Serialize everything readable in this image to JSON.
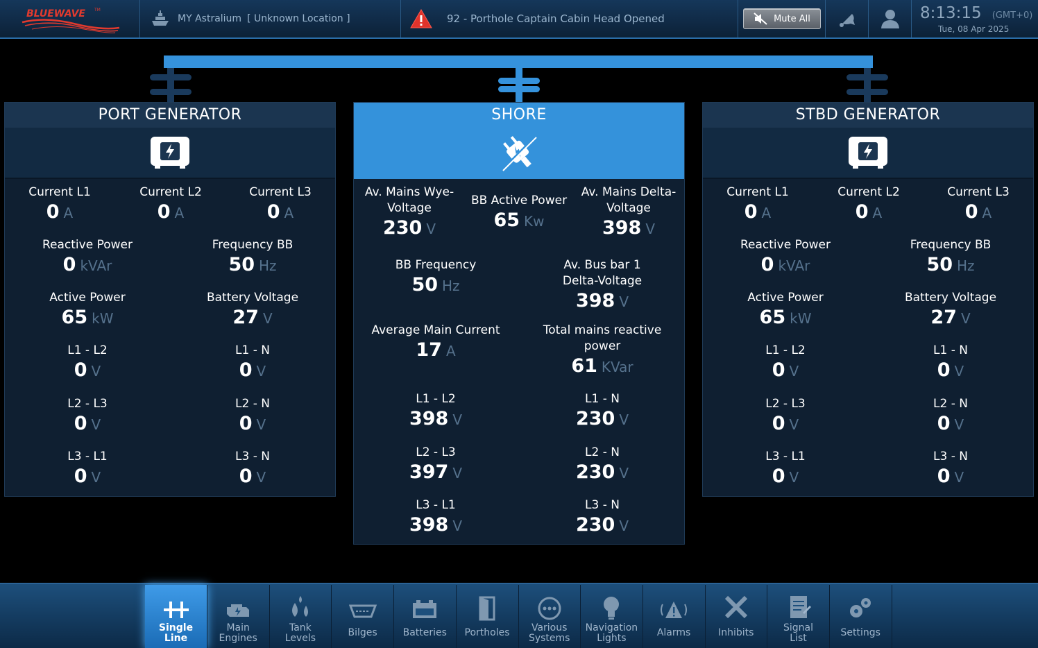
{
  "header": {
    "vessel_name": "MY Astralium",
    "location": "[ Unknown Location ]",
    "alarm_text": "92 - Porthole Captain Cabin Head Opened",
    "mute_label": "Mute All",
    "time": "8:13:15",
    "timezone": "(GMT+0)",
    "date": "Tue, 08 Apr 2025"
  },
  "port": {
    "title": "PORT GENERATOR",
    "fields": [
      {
        "label": "Current L1",
        "value": "0",
        "unit": "A"
      },
      {
        "label": "Current L2",
        "value": "0",
        "unit": "A"
      },
      {
        "label": "Current L3",
        "value": "0",
        "unit": "A"
      },
      {
        "label": "Reactive Power",
        "value": "0",
        "unit": "kVAr"
      },
      {
        "label": "Frequency BB",
        "value": "50",
        "unit": "Hz"
      },
      {
        "label": "Active Power",
        "value": "65",
        "unit": "kW"
      },
      {
        "label": "Battery Voltage",
        "value": "27",
        "unit": "V"
      },
      {
        "label": "L1 - L2",
        "value": "0",
        "unit": "V"
      },
      {
        "label": "L1 - N",
        "value": "0",
        "unit": "V"
      },
      {
        "label": "L2 - L3",
        "value": "0",
        "unit": "V"
      },
      {
        "label": "L2 - N",
        "value": "0",
        "unit": "V"
      },
      {
        "label": "L3 - L1",
        "value": "0",
        "unit": "V"
      },
      {
        "label": "L3 - N",
        "value": "0",
        "unit": "V"
      }
    ]
  },
  "shore": {
    "title": "SHORE",
    "fields": [
      {
        "label": "Av. Mains Wye-Voltage",
        "value": "230",
        "unit": "V"
      },
      {
        "label": "BB Active Power",
        "value": "65",
        "unit": "Kw"
      },
      {
        "label": "Av. Mains Delta-Voltage",
        "value": "398",
        "unit": "V"
      },
      {
        "label": "BB Frequency",
        "value": "50",
        "unit": "Hz"
      },
      {
        "label": "Av. Bus bar 1 Delta-Voltage",
        "value": "398",
        "unit": "V"
      },
      {
        "label": "Average Main Current",
        "value": "17",
        "unit": "A"
      },
      {
        "label": "Total mains reactive power",
        "value": "61",
        "unit": "KVar"
      },
      {
        "label": "L1 - L2",
        "value": "398",
        "unit": "V"
      },
      {
        "label": "L1 - N",
        "value": "230",
        "unit": "V"
      },
      {
        "label": "L2 - L3",
        "value": "397",
        "unit": "V"
      },
      {
        "label": "L2 - N",
        "value": "230",
        "unit": "V"
      },
      {
        "label": "L3 - L1",
        "value": "398",
        "unit": "V"
      },
      {
        "label": "L3 - N",
        "value": "230",
        "unit": "V"
      }
    ]
  },
  "stbd": {
    "title": "STBD GENERATOR",
    "fields": [
      {
        "label": "Current L1",
        "value": "0",
        "unit": "A"
      },
      {
        "label": "Current L2",
        "value": "0",
        "unit": "A"
      },
      {
        "label": "Current L3",
        "value": "0",
        "unit": "A"
      },
      {
        "label": "Reactive Power",
        "value": "0",
        "unit": "kVAr"
      },
      {
        "label": "Frequency BB",
        "value": "50",
        "unit": "Hz"
      },
      {
        "label": "Active Power",
        "value": "65",
        "unit": "kW"
      },
      {
        "label": "Battery Voltage",
        "value": "27",
        "unit": "V"
      },
      {
        "label": "L1 - L2",
        "value": "0",
        "unit": "V"
      },
      {
        "label": "L1 - N",
        "value": "0",
        "unit": "V"
      },
      {
        "label": "L2 - L3",
        "value": "0",
        "unit": "V"
      },
      {
        "label": "L2 - N",
        "value": "0",
        "unit": "V"
      },
      {
        "label": "L3 - L1",
        "value": "0",
        "unit": "V"
      },
      {
        "label": "L3 - N",
        "value": "0",
        "unit": "V"
      }
    ]
  },
  "nav": [
    {
      "label": "Single Line",
      "icon": "single-line-icon",
      "active": true
    },
    {
      "label": "Main Engines",
      "icon": "engine-icon",
      "active": false
    },
    {
      "label": "Tank Levels",
      "icon": "drops-icon",
      "active": false
    },
    {
      "label": "Bilges",
      "icon": "bilge-icon",
      "active": false
    },
    {
      "label": "Batteries",
      "icon": "battery-icon",
      "active": false
    },
    {
      "label": "Portholes",
      "icon": "door-icon",
      "active": false
    },
    {
      "label": "Various Systems",
      "icon": "dots-icon",
      "active": false
    },
    {
      "label": "Navigation Lights",
      "icon": "bulb-icon",
      "active": false
    },
    {
      "label": "Alarms",
      "icon": "alarm-icon",
      "active": false
    },
    {
      "label": "Inhibits",
      "icon": "x-icon",
      "active": false
    },
    {
      "label": "Signal List",
      "icon": "list-icon",
      "active": false
    },
    {
      "label": "Settings",
      "icon": "gears-icon",
      "active": false
    }
  ],
  "colors": {
    "bus": "#3592dc",
    "panel_header": "#1b3550",
    "active_panel": "#3492db",
    "unit_text": "#55718c"
  }
}
